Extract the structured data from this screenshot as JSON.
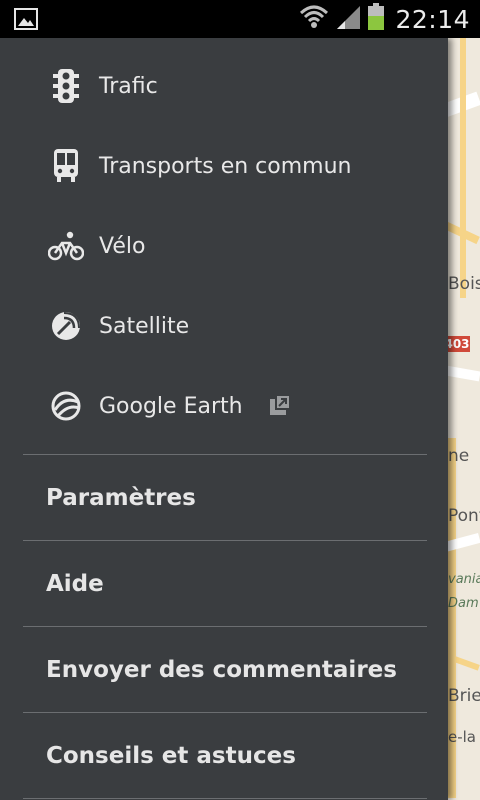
{
  "status_bar": {
    "time": "22:14",
    "icons": [
      "image-notification-icon",
      "wifi-icon",
      "signal-icon",
      "battery-icon"
    ]
  },
  "map": {
    "labels": [
      "Bois",
      "403",
      "ne",
      "Pont",
      "vanial",
      "Dam",
      "Brie",
      "e-la"
    ]
  },
  "drawer": {
    "layers": [
      {
        "label": "Trafic",
        "icon": "traffic-light-icon"
      },
      {
        "label": "Transports en commun",
        "icon": "transit-icon"
      },
      {
        "label": "Vélo",
        "icon": "bicycle-icon"
      },
      {
        "label": "Satellite",
        "icon": "satellite-icon"
      },
      {
        "label": "Google Earth",
        "icon": "earth-icon",
        "external_icon": "open-external-icon"
      }
    ],
    "sections": [
      {
        "label": "Paramètres"
      },
      {
        "label": "Aide"
      },
      {
        "label": "Envoyer des commentaires"
      },
      {
        "label": "Conseils et astuces"
      }
    ]
  },
  "colors": {
    "drawer_bg": "#3a3d40",
    "text": "#e8e8e8",
    "divider": "#6b6e71",
    "battery": "#8cc63f"
  }
}
